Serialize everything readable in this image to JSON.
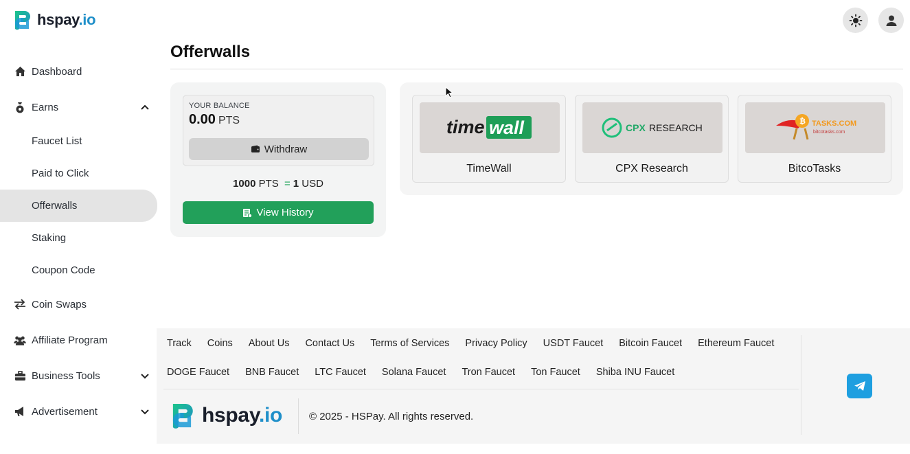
{
  "app": {
    "logo_text": "hspay",
    "logo_suffix": ".io"
  },
  "header": {
    "theme_toggle_icon": "sun-icon",
    "user_icon": "user-icon"
  },
  "sidebar": {
    "dashboard": "Dashboard",
    "earns": "Earns",
    "earns_sub": [
      "Faucet List",
      "Paid to Click",
      "Offerwalls",
      "Staking",
      "Coupon Code"
    ],
    "active_sub": "Offerwalls",
    "coin_swaps": "Coin Swaps",
    "affiliate": "Affiliate Program",
    "business_tools": "Business Tools",
    "advertisement": "Advertisement"
  },
  "main": {
    "title": "Offerwalls",
    "balance": {
      "label": "YOUR BALANCE",
      "value": "0.00",
      "unit": "PTS",
      "withdraw_label": "Withdraw",
      "rate_pts": "1000",
      "rate_pts_unit": "PTS",
      "rate_eq": "=",
      "rate_usd": "1",
      "rate_usd_unit": "USD",
      "history_label": "View History"
    },
    "offerwalls": [
      {
        "name": "TimeWall",
        "logo_a": "time",
        "logo_b": "wall"
      },
      {
        "name": "CPX Research",
        "logo_a": "CPX",
        "logo_b": "RESEARCH"
      },
      {
        "name": "BitcoTasks",
        "logo_a": "TASKS.COM",
        "logo_b": "bitcotasks.com"
      }
    ]
  },
  "footer": {
    "links_row1": [
      "Track",
      "Coins",
      "About Us",
      "Contact Us",
      "Terms of Services",
      "Privacy Policy",
      "USDT Faucet",
      "Bitcoin Faucet",
      "Ethereum Faucet"
    ],
    "links_row2": [
      "DOGE Faucet",
      "BNB Faucet",
      "LTC Faucet",
      "Solana Faucet",
      "Tron Faucet",
      "Ton Faucet",
      "Shiba INU Faucet"
    ],
    "copyright": "© 2025 - HSPay. All rights reserved.",
    "telegram_icon": "telegram-icon"
  },
  "colors": {
    "brand_green": "#22a05a",
    "brand_teal": "#1bb39a",
    "brand_blue": "#1f8fc9",
    "telegram_blue": "#1e9fe0"
  }
}
